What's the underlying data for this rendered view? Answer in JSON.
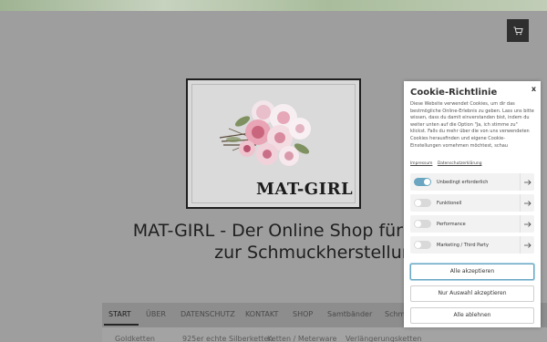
{
  "header": {
    "cart_icon": "cart-icon"
  },
  "logo": {
    "text": "MAT-GIRL"
  },
  "site": {
    "title_line1": "MAT-GIRL - Der Online Shop für Materialien",
    "title_line2": "zur Schmuckherstellung"
  },
  "nav": {
    "items": [
      "START",
      "ÜBER",
      "DATENSCHUTZ",
      "KONTAKT",
      "SHOP",
      "Samtbänder",
      "Schmuck"
    ]
  },
  "subnav": {
    "items": [
      "Goldketten",
      "925er echte Silberketten",
      "Ketten / Meterware",
      "Verlängerungsketten"
    ]
  },
  "cookie": {
    "close": "x",
    "title": "Cookie-Richtlinie",
    "text": "Diese Website verwendet Cookies, um dir das bestmögliche Online-Erlebnis zu geben. Lass uns bitte wissen, dass du damit einverstanden bist, indem du weiter unten auf die Option \"Ja, ich stimme zu\" klickst. Falls du mehr über die von uns verwendeten Cookies herausfinden und eigene Cookie-Einstellungen vornehmen möchtest, schau",
    "link_impressum": "Impressum",
    "link_datenschutz": "Datenschutzerklärung",
    "options": [
      {
        "label": "Unbedingt erforderlich",
        "enabled": true
      },
      {
        "label": "Funktionell",
        "enabled": false
      },
      {
        "label": "Performance",
        "enabled": false
      },
      {
        "label": "Marketing / Third Party",
        "enabled": false
      }
    ],
    "accept_all": "Alle akzeptieren",
    "accept_selection": "Nur Auswahl akzeptieren",
    "reject_all": "Alle ablehnen"
  },
  "colors": {
    "accent": "#6aa6c2",
    "overlay": "#9e9e9e",
    "dark": "#2f2f2f"
  }
}
